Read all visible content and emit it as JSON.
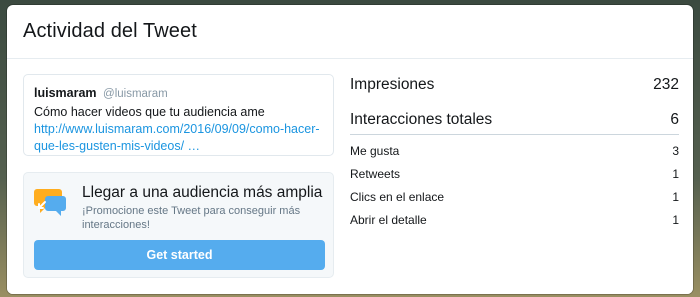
{
  "modal": {
    "title": "Actividad del Tweet"
  },
  "tweet": {
    "author": "luismaram",
    "handle": "@luismaram",
    "text": "Cómo hacer videos que tu audiencia ame",
    "link": "http://www.luismaram.com/2016/09/09/como-hacer-que-les-gusten-mis-videos/ …"
  },
  "promo": {
    "icon": "megaphone-speech-bubble-icon",
    "title": "Llegar a una audiencia más amplia",
    "description": "¡Promocione este Tweet para conseguir más interacciones!",
    "button_label": "Get started"
  },
  "stats": {
    "impressions": {
      "label": "Impresiones",
      "value": "232"
    },
    "total_engagements": {
      "label": "Interacciones totales",
      "value": "6"
    },
    "likes": {
      "label": "Me gusta",
      "value": "3"
    },
    "retweets": {
      "label": "Retweets",
      "value": "1"
    },
    "link_clicks": {
      "label": "Clics en el enlace",
      "value": "1"
    },
    "detail_expands": {
      "label": "Abrir el detalle",
      "value": "1"
    }
  },
  "colors": {
    "accent": "#55acee",
    "link": "#1b95e0",
    "text": "#14171a",
    "muted": "#657786"
  }
}
